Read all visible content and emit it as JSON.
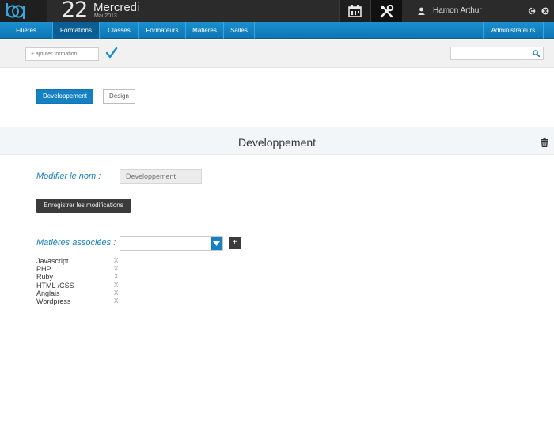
{
  "header": {
    "logo_text": "bp",
    "day_number": "22",
    "weekday": "Mercredi",
    "month_year": "Mai 2013",
    "user_name": "Hamon Arthur"
  },
  "nav": {
    "items": [
      {
        "label": "Filières"
      },
      {
        "label": "Formations"
      },
      {
        "label": "Classes"
      },
      {
        "label": "Formateurs"
      },
      {
        "label": "Matières"
      },
      {
        "label": "Salles"
      }
    ],
    "active": "Formations",
    "admin_label": "Administrateurs"
  },
  "toolbar": {
    "add_placeholder": "+ ajouter formation",
    "search_placeholder": ""
  },
  "categories": {
    "primary_label": "Developpement",
    "secondary_label": "Design"
  },
  "section": {
    "title": "Developpement"
  },
  "form": {
    "rename_label": "Modifier le nom :",
    "rename_value": "Developpement",
    "save_label": "Enregistrer les modifications",
    "subjects_label": "Matières associées :",
    "subjects_select_value": "",
    "add_label": "+"
  },
  "subjects": [
    {
      "name": "Javascript",
      "remove": "X"
    },
    {
      "name": "PHP",
      "remove": "X"
    },
    {
      "name": "Ruby",
      "remove": "X"
    },
    {
      "name": "HTML /CSS",
      "remove": "X"
    },
    {
      "name": "Anglais",
      "remove": "X"
    },
    {
      "name": "Wordpress",
      "remove": "X"
    }
  ],
  "colors": {
    "accent": "#1581c2",
    "topbar": "#2b2b2b",
    "label_blue": "#1a7fbf"
  }
}
